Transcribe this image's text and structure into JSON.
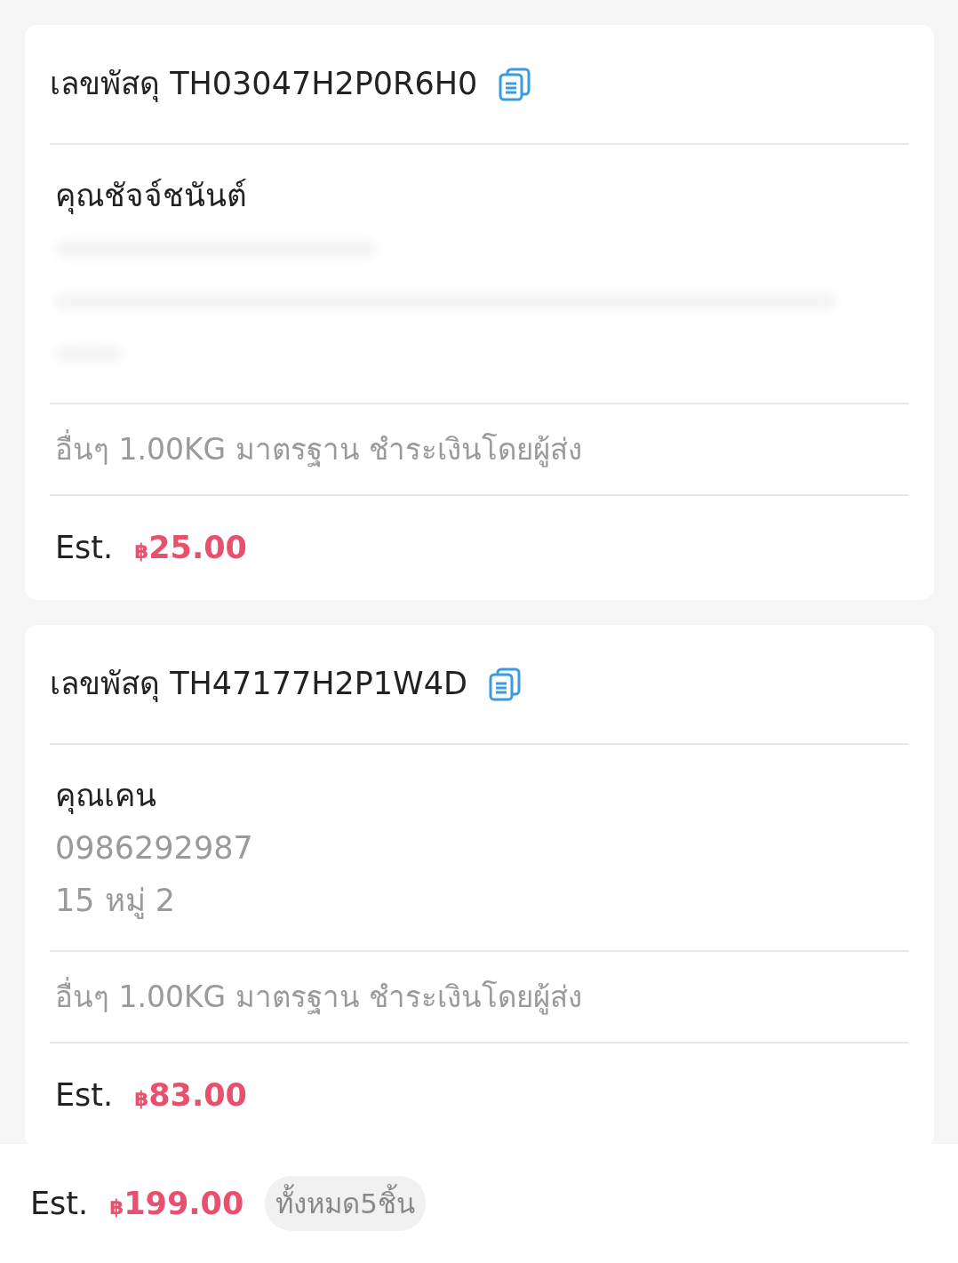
{
  "parcels": [
    {
      "label": "เลขพัสดุ",
      "tracking": "TH03047H2P0R6H0",
      "recipient": "คุณชัจจ์ชนันต์",
      "details_blurred": true,
      "info": "อื่นๆ 1.00KG  มาตรฐาน ชำระเงินโดยผู้ส่ง",
      "est_label": "Est.",
      "currency": "฿",
      "price": "25.00"
    },
    {
      "label": "เลขพัสดุ",
      "tracking": "TH47177H2P1W4D",
      "recipient": "คุณเคน",
      "phone": "0986292987",
      "address": "15 หมู่ 2",
      "info": "อื่นๆ 1.00KG  มาตรฐาน ชำระเงินโดยผู้ส่ง",
      "est_label": "Est.",
      "currency": "฿",
      "price": "83.00"
    }
  ],
  "footer": {
    "est_label": "Est.",
    "currency": "฿",
    "total": "199.00",
    "count": "ทั้งหมด5ชิ้น"
  }
}
